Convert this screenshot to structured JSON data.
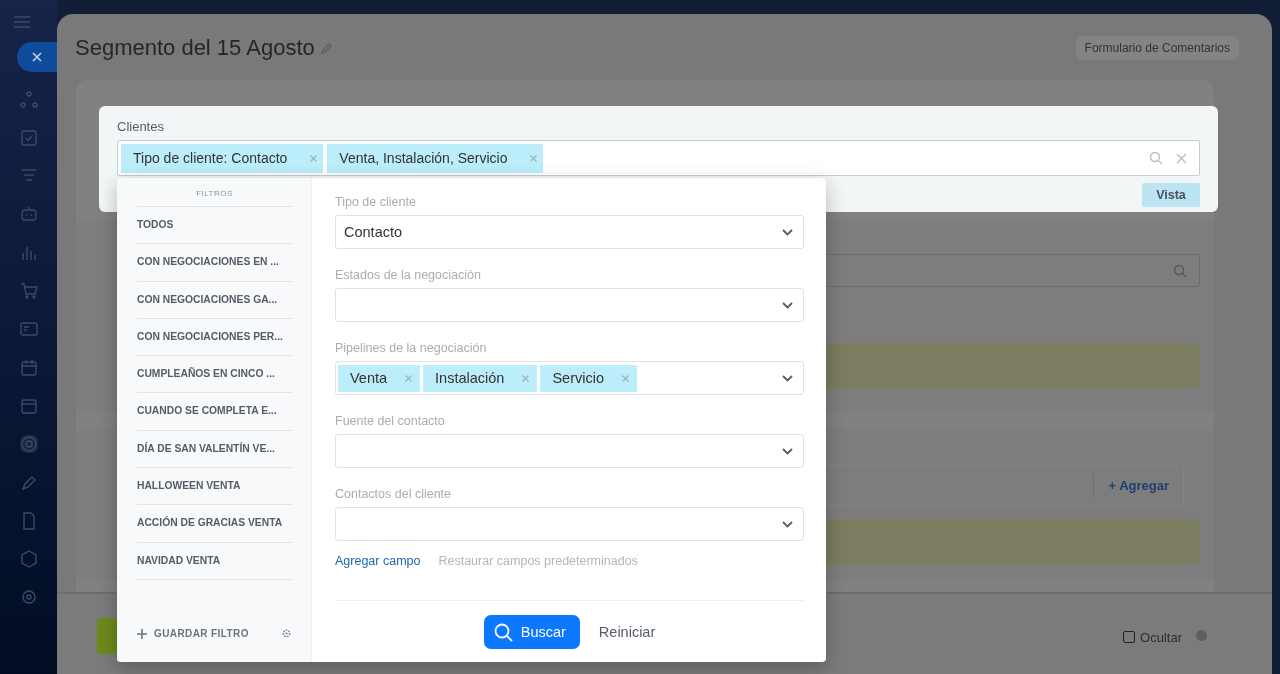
{
  "page": {
    "title": "Segmento del 15 Agosto",
    "feedback_button": "Formulario de Comentarios"
  },
  "filter_bar": {
    "label": "Clientes",
    "chips": [
      "Tipo de cliente: Contacto",
      "Venta, Instalación, Servicio"
    ],
    "view_button": "Vista"
  },
  "filter_popup": {
    "heading": "FILTROS",
    "presets": [
      "TODOS",
      "CON NEGOCIACIONES EN ...",
      "CON NEGOCIACIONES GA...",
      "CON NEGOCIACIONES PER...",
      "CUMPLEAÑOS EN CINCO ...",
      "CUANDO SE COMPLETA E...",
      "DÍA DE SAN VALENTÍN VE...",
      "HALLOWEEN VENTA",
      "ACCIÓN DE GRACIAS VENTA",
      "NAVIDAD VENTA"
    ],
    "save_filter": "GUARDAR FILTRO",
    "fields": [
      {
        "label": "Tipo de cliente",
        "kind": "select",
        "value": "Contacto"
      },
      {
        "label": "Estados de la negociación",
        "kind": "select"
      },
      {
        "label": "Pipelines de la negociación",
        "kind": "tags",
        "tags": [
          "Venta",
          "Instalación",
          "Servicio"
        ]
      },
      {
        "label": "Fuente del contacto",
        "kind": "select"
      },
      {
        "label": "Contactos del cliente",
        "kind": "select"
      }
    ],
    "add_field": "Agregar campo",
    "restore_fields": "Restaurar campos predeterminados",
    "search_button": "Buscar",
    "reset_button": "Reiniciar"
  },
  "background": {
    "add_button": "+ Agregar",
    "hide_checkbox": {
      "label": "Ocultar",
      "checked": false
    }
  }
}
